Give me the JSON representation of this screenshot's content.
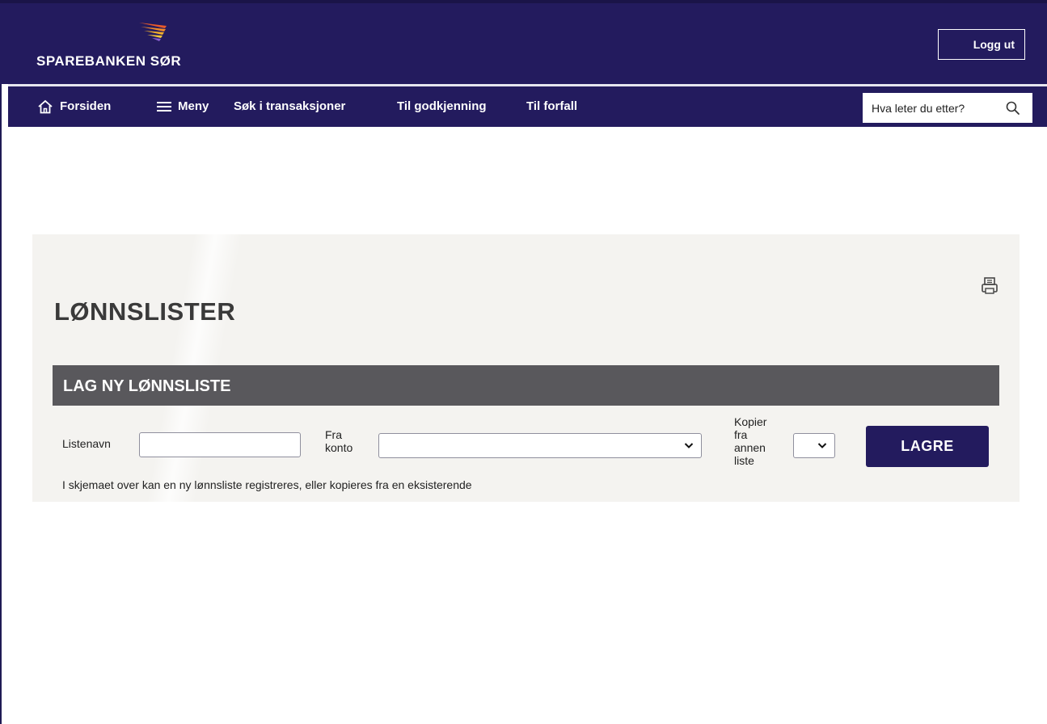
{
  "header": {
    "logo_text": "SPAREBANKEN SØR",
    "logout_label": "Logg ut"
  },
  "nav": {
    "items": [
      {
        "label": "Forsiden",
        "icon": "home-icon"
      },
      {
        "label": "Meny",
        "icon": "hamburger-menu-icon"
      },
      {
        "label": "Søk i transaksjoner"
      },
      {
        "label": "Til godkjenning"
      },
      {
        "label": "Til forfall"
      }
    ],
    "search_placeholder": "Hva leter du etter?"
  },
  "page": {
    "title": "LØNNSLISTER",
    "section_title": "LAG NY LØNNSLISTE",
    "form": {
      "list_name_label": "Listenavn",
      "list_name_value": "",
      "from_account_label_1": "Fra",
      "from_account_label_2": "konto",
      "from_account_value": "",
      "copy_label_1": "Kopier",
      "copy_label_2": "fra",
      "copy_label_3": "annen",
      "copy_label_4": "liste",
      "copy_value": "",
      "save_label": "LAGRE"
    },
    "help_text": "I skjemaet over kan en ny lønnsliste registreres, eller kopieres fra en eksisterende"
  },
  "colors": {
    "brand_navy": "#231b5e",
    "section_bar": "#59585c",
    "panel_bg": "#f4f3f0"
  }
}
